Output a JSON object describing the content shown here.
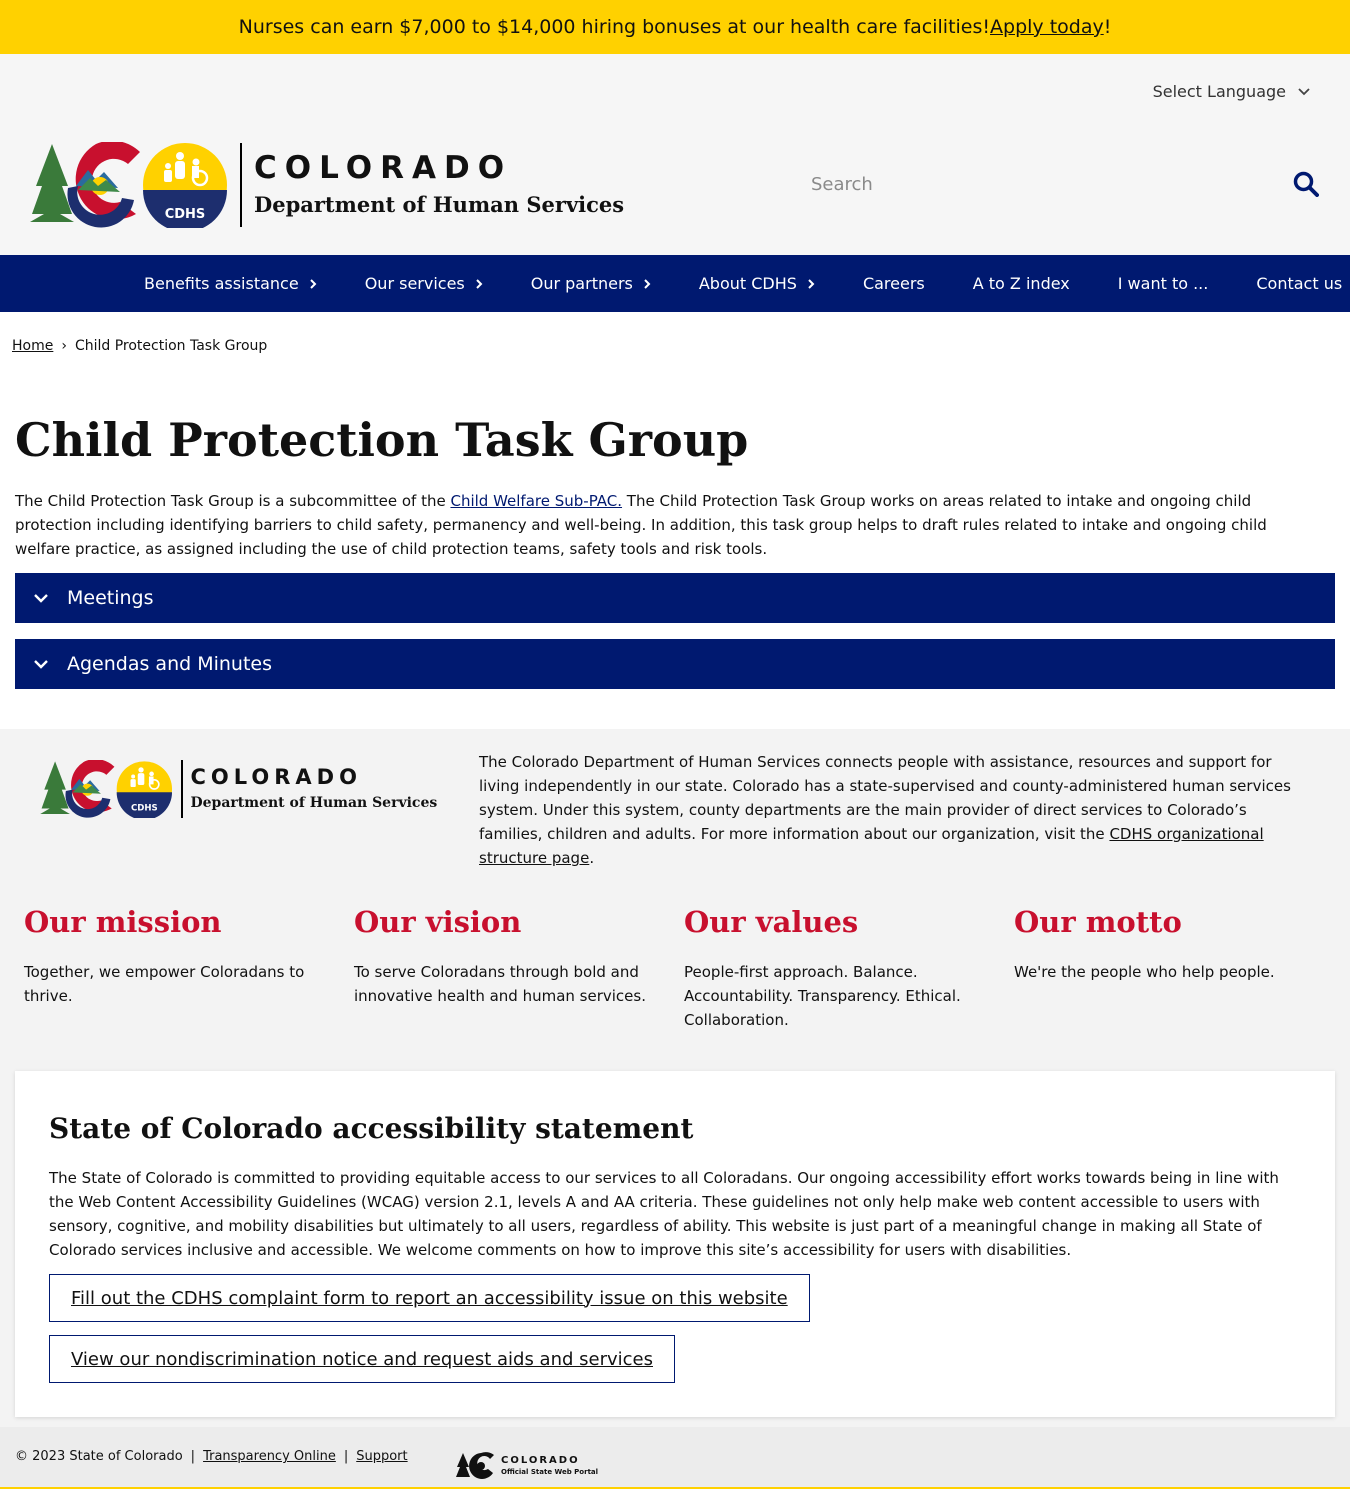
{
  "alert": {
    "text": "Nurses can earn $7,000 to $14,000 hiring bonuses at our health care facilities! ",
    "link": "Apply today",
    "suffix": "!"
  },
  "header": {
    "language_label": "Select Language",
    "logo_title": "COLORADO",
    "logo_subtitle": "Department of Human Services",
    "logo_badge": "CDHS",
    "search_placeholder": "Search"
  },
  "nav": {
    "items": [
      {
        "label": "Benefits assistance",
        "has_submenu": true
      },
      {
        "label": "Our services",
        "has_submenu": true
      },
      {
        "label": "Our partners",
        "has_submenu": true
      },
      {
        "label": "About CDHS",
        "has_submenu": true
      },
      {
        "label": "Careers",
        "has_submenu": false
      },
      {
        "label": "A to Z index",
        "has_submenu": false
      },
      {
        "label": "I want to ...",
        "has_submenu": false
      },
      {
        "label": "Contact us",
        "has_submenu": false
      }
    ]
  },
  "breadcrumb": {
    "home": "Home",
    "separator": "›",
    "current": "Child Protection Task Group"
  },
  "main": {
    "title": "Child Protection Task Group",
    "intro_before": "The Child Protection Task Group is a subcommittee of the ",
    "intro_link": "Child Welfare Sub-PAC.",
    "intro_after": " The Child Protection Task Group works on areas related to intake and ongoing child protection including identifying barriers to child safety, permanency and well-being. In addition, this task group helps to draft rules related to intake and ongoing child welfare practice, as assigned including the use of child protection teams, safety tools and risk tools.",
    "accordions": [
      {
        "label": "Meetings"
      },
      {
        "label": "Agendas and Minutes"
      }
    ]
  },
  "footer": {
    "logo_title": "COLORADO",
    "logo_subtitle": "Department of Human Services",
    "logo_badge": "CDHS",
    "about_text": "The Colorado Department of Human Services connects people with assistance, resources and support for living independently in our state. Colorado has a state-supervised and county-administered human services system. Under this system, county departments are the main provider of direct services to Colorado’s families, children and adults. For more information about our organization, visit the ",
    "about_link": "CDHS organizational structure page",
    "about_suffix": ".",
    "columns": [
      {
        "heading": "Our mission",
        "text": "Together, we empower Coloradans to thrive."
      },
      {
        "heading": "Our vision",
        "text": "To serve Coloradans through bold and innovative health and human services."
      },
      {
        "heading": "Our values",
        "text": "People-first approach. Balance. Accountability. Transparency. Ethical. Collaboration."
      },
      {
        "heading": "Our motto",
        "text": "We're the people who help people."
      }
    ],
    "accessibility": {
      "heading": "State of Colorado accessibility statement",
      "text": "The State of Colorado is committed to providing equitable access to our services to all Coloradans. Our ongoing accessibility effort works towards being in line with the Web Content Accessibility Guidelines (WCAG) version 2.1, levels A and AA criteria. These guidelines not only help make web content accessible to users with sensory, cognitive, and mobility disabilities but ultimately to all users, regardless of ability. This website is just part of a meaningful change in making all State of Colorado services inclusive and accessible. We welcome comments on how to improve this site’s accessibility for users with disabilities.",
      "button_complaint": "Fill out the CDHS complaint form to report an accessibility issue on this website",
      "button_nondiscrimination": "View our nondiscrimination notice and request aids and services"
    }
  },
  "bottom": {
    "copyright": "© 2023 State of Colorado",
    "separator": "|",
    "transparency": "Transparency Online",
    "support": "Support",
    "portal_title": "COLORADO",
    "portal_subtitle": "Official State Web Portal"
  },
  "colors": {
    "alert_bg": "#ffd100",
    "navy": "#001970",
    "accent_red": "#c8102e",
    "footer_bg": "#f3f3f3"
  },
  "icons": [
    "chevron-down-icon",
    "search-icon",
    "chevron-right-icon",
    "colorado-logo-icon",
    "cdhs-badge-icon"
  ]
}
